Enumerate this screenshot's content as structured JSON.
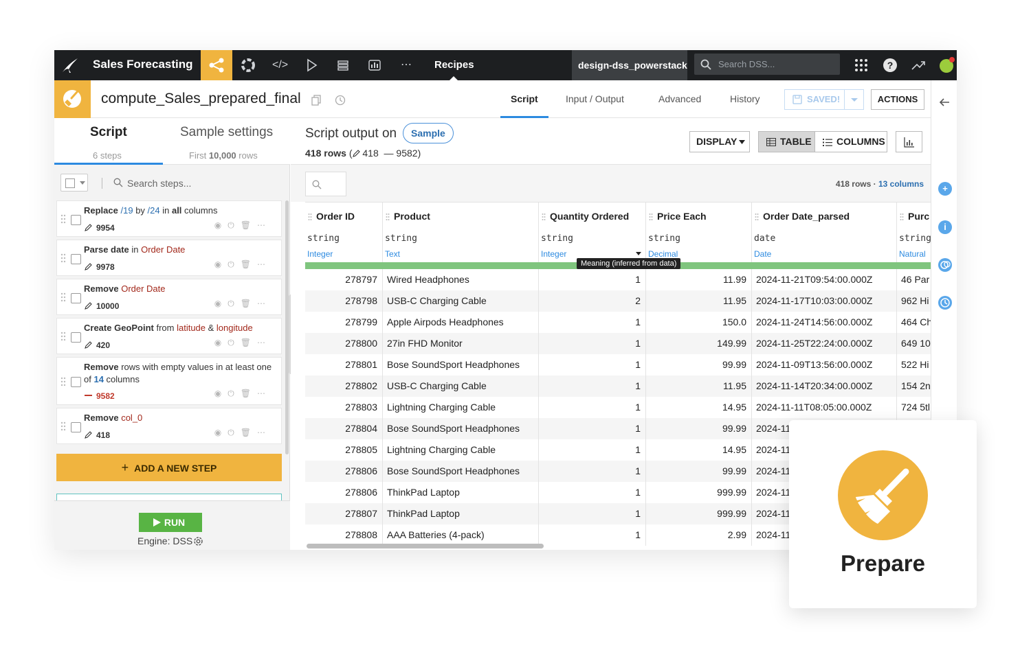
{
  "topnav": {
    "project_name": "Sales Forecasting",
    "current_section": "Recipes",
    "instance_name": "design-dss_powerstack",
    "search_placeholder": "Search DSS..."
  },
  "recipe": {
    "name": "compute_Sales_prepared_final",
    "tabs": [
      "Script",
      "Input / Output",
      "Advanced",
      "History"
    ],
    "active_tab": "Script",
    "saved_label": "SAVED!",
    "actions_label": "ACTIONS"
  },
  "left_panel": {
    "tab_script": "Script",
    "tab_script_sub": "6 steps",
    "tab_sample": "Sample settings",
    "tab_sample_sub_pre": "First ",
    "tab_sample_sub_num": "10,000",
    "tab_sample_sub_post": " rows",
    "search_placeholder": "Search steps...",
    "steps": [
      {
        "count": "9954"
      },
      {
        "count": "9978"
      },
      {
        "count": "10000"
      },
      {
        "count": "420"
      },
      {
        "count": "9582"
      },
      {
        "count": "418"
      }
    ],
    "step_text": {
      "s1": {
        "a": "Replace",
        "b": "/19",
        "c": " by ",
        "d": "/24",
        "e": " in ",
        "f": "all",
        "g": " columns"
      },
      "s2": {
        "a": "Parse date",
        "b": " in ",
        "c": "Order Date"
      },
      "s3": {
        "a": "Remove",
        "b": " ",
        "c": "Order Date"
      },
      "s4": {
        "a": "Create GeoPoint",
        "b": " from ",
        "c": "latitude",
        "d": " & ",
        "e": "longitude"
      },
      "s5": {
        "a": "Remove",
        "b": " rows with empty values in at least one of ",
        "c": "14",
        "d": " columns"
      },
      "s6": {
        "a": "Remove",
        "b": " ",
        "c": "col_0"
      }
    },
    "add_step_label": "ADD A NEW STEP",
    "run_label": "RUN",
    "engine_label": "Engine: DSS"
  },
  "main": {
    "title": "Script output on",
    "sample_pill": "Sample",
    "rows_label": "418 rows",
    "rows_detail_edit": "418",
    "rows_detail_removed": "9582",
    "display_label": "DISPLAY",
    "table_label": "TABLE",
    "columns_label": "COLUMNS",
    "row_count": "418 rows",
    "column_count": "13 columns",
    "tooltip": "Meaning (inferred from data)",
    "columns": [
      {
        "name": "Order ID",
        "type": "string",
        "meaning": "Integer"
      },
      {
        "name": "Product",
        "type": "string",
        "meaning": "Text"
      },
      {
        "name": "Quantity Ordered",
        "type": "string",
        "meaning": "Integer"
      },
      {
        "name": "Price Each",
        "type": "string",
        "meaning": "Decimal"
      },
      {
        "name": "Order Date_parsed",
        "type": "date",
        "meaning": "Date"
      },
      {
        "name": "Purc",
        "type": "string",
        "meaning": "Natural"
      }
    ],
    "rows": [
      [
        "278797",
        "Wired Headphones",
        "1",
        "11.99",
        "2024-11-21T09:54:00.000Z",
        "46 Par"
      ],
      [
        "278798",
        "USB-C Charging Cable",
        "2",
        "11.95",
        "2024-11-17T10:03:00.000Z",
        "962 Hi"
      ],
      [
        "278799",
        "Apple Airpods Headphones",
        "1",
        "150.0",
        "2024-11-24T14:56:00.000Z",
        "464 Ch"
      ],
      [
        "278800",
        "27in FHD Monitor",
        "1",
        "149.99",
        "2024-11-25T22:24:00.000Z",
        "649 10"
      ],
      [
        "278801",
        "Bose SoundSport Headphones",
        "1",
        "99.99",
        "2024-11-09T13:56:00.000Z",
        "522 Hi"
      ],
      [
        "278802",
        "USB-C Charging Cable",
        "1",
        "11.95",
        "2024-11-14T20:34:00.000Z",
        "154 2n"
      ],
      [
        "278803",
        "Lightning Charging Cable",
        "1",
        "14.95",
        "2024-11-11T08:05:00.000Z",
        "724 5tl"
      ],
      [
        "278804",
        "Bose SoundSport Headphones",
        "1",
        "99.99",
        "2024-11",
        ""
      ],
      [
        "278805",
        "Lightning Charging Cable",
        "1",
        "14.95",
        "2024-11",
        ""
      ],
      [
        "278806",
        "Bose SoundSport Headphones",
        "1",
        "99.99",
        "2024-11",
        ""
      ],
      [
        "278806",
        "ThinkPad Laptop",
        "1",
        "999.99",
        "2024-11",
        ""
      ],
      [
        "278807",
        "ThinkPad Laptop",
        "1",
        "999.99",
        "2024-11",
        ""
      ],
      [
        "278808",
        "AAA Batteries (4-pack)",
        "1",
        "2.99",
        "2024-11",
        ""
      ]
    ]
  },
  "prepare_card": {
    "label": "Prepare"
  },
  "colors": {
    "nav_bg": "#1d1f21",
    "accent_orange": "#f0b43f",
    "run_green": "#58b444",
    "link_blue": "#2c6fb0",
    "column_red": "#a2281b"
  }
}
